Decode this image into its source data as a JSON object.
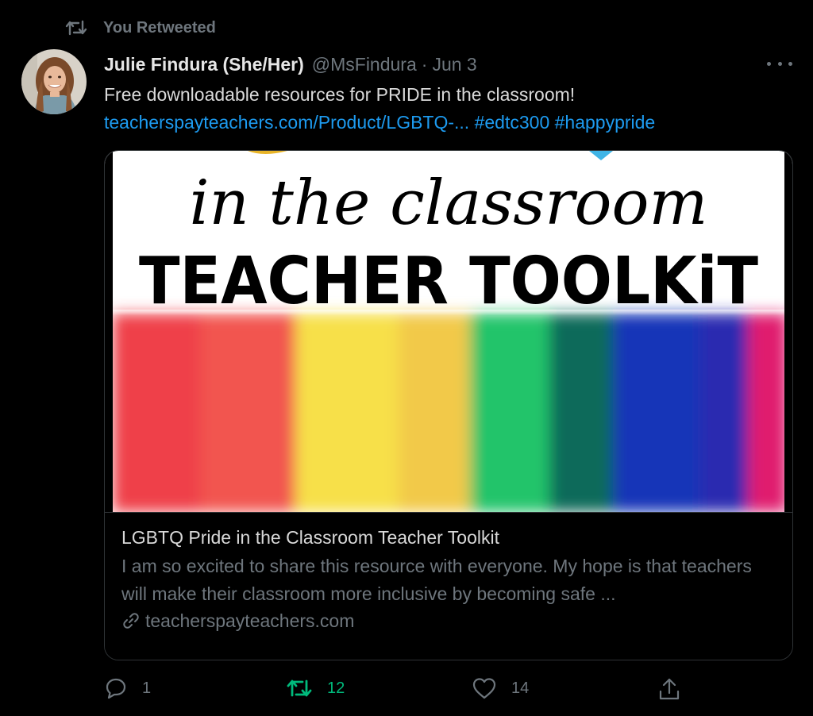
{
  "retweet_context": {
    "label": "You Retweeted",
    "icon": "retweet-icon"
  },
  "tweet": {
    "author": {
      "display_name": "Julie Findura (She/Her)",
      "handle": "@MsFindura",
      "separator": "·",
      "date": "Jun 3"
    },
    "text": "Free downloadable resources for PRIDE in the classroom!",
    "link_text": "teacherspayteachers.com/Product/LGBTQ-...",
    "hashtags": [
      "#edtc300",
      "#happypride"
    ]
  },
  "card": {
    "image_text": {
      "script_line": "in the classroom",
      "headline": "TEACHER TOOLKiT"
    },
    "title": "LGBTQ Pride in the Classroom Teacher Toolkit",
    "description": "I am so excited to share this resource with everyone. My hope is that teachers will make their classroom more inclusive by becoming safe ...",
    "domain": "teacherspayteachers.com"
  },
  "actions": {
    "replies": "1",
    "retweets": "12",
    "likes": "14"
  },
  "colors": {
    "background": "#000000",
    "link": "#1d9bf0",
    "muted": "#6e767d",
    "retweet_active": "#00ba7c"
  }
}
